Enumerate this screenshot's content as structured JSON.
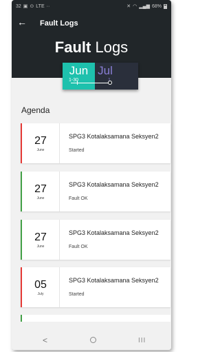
{
  "status_bar": {
    "time": "32",
    "left_icons": [
      "gallery-icon",
      "sync-icon",
      "lte-icon",
      "more-icon"
    ],
    "battery": "68%"
  },
  "header": {
    "title": "Fault Logs",
    "big_title_bold": "Fault",
    "big_title_rest": " Logs"
  },
  "month_picker": {
    "active_month": "Jun",
    "next_month": "Jul",
    "range_start": "1-30",
    "range_end": "1"
  },
  "agenda": {
    "title": "Agenda",
    "items": [
      {
        "day": "27",
        "month": "June",
        "title": "SPG3 Kotalaksamana Seksyen2",
        "status": "Started",
        "accent": "#e53935"
      },
      {
        "day": "27",
        "month": "June",
        "title": "SPG3 Kotalaksamana Seksyen2",
        "status": "Fault OK",
        "accent": "#43a047"
      },
      {
        "day": "27",
        "month": "June",
        "title": "SPG3 Kotalaksamana Seksyen2",
        "status": "Fault OK",
        "accent": "#43a047"
      },
      {
        "day": "05",
        "month": "July",
        "title": "SPG3 Kotalaksamana Seksyen2",
        "status": "Started",
        "accent": "#e53935"
      }
    ]
  },
  "nav": {
    "back": "<",
    "recent": "III"
  },
  "colors": {
    "header_bg": "#212629",
    "month_active": "#1ec1ad",
    "month_next_text": "#8a7fd6",
    "status_started": "#e53935",
    "status_ok": "#43a047"
  }
}
